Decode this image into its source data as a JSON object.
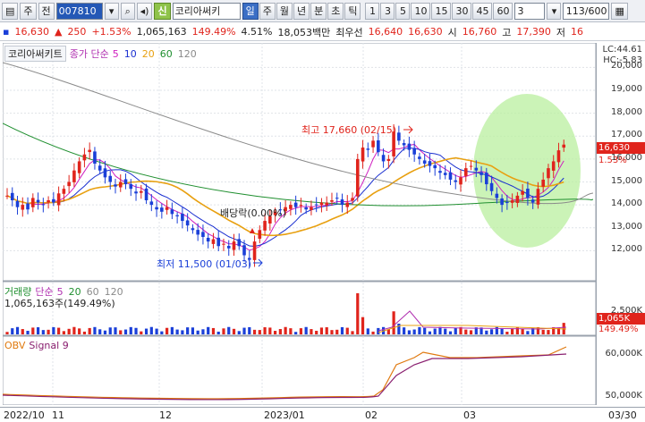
{
  "toolbar": {
    "market_label": "주",
    "prev_label": "전",
    "code_value": "007810",
    "type_badge": "신",
    "name_value": "코리아써키",
    "periods": [
      "일",
      "주",
      "월",
      "년",
      "분",
      "초",
      "틱"
    ],
    "selected_period": "일",
    "intervals": [
      "1",
      "3",
      "5",
      "10",
      "15",
      "30",
      "45",
      "60"
    ],
    "interval_value": "3",
    "count_value": "113/600"
  },
  "quote": {
    "price": "16,630",
    "arrow": "▲",
    "change": "250",
    "change_rate": "+1.53%",
    "volume": "1,065,163",
    "volume_ratio": "149.49%",
    "turnover": "4.51%",
    "amount": "18,053백만",
    "best_ask_label": "최우선",
    "best_ask": "16,640",
    "best_bid": "16,630",
    "open_label": "시",
    "open": "16,760",
    "high_label": "고",
    "high": "17,390",
    "low_label": "저",
    "low": "16"
  },
  "price_pane": {
    "stock_name": "코리아써키트",
    "ma_label": "종가 단순",
    "ma_periods": [
      "5",
      "10",
      "20",
      "60",
      "120"
    ],
    "ma_colors": [
      "#d020c0",
      "#1a2fd0",
      "#e8a010",
      "#1f8f2f",
      "#8a8a8a"
    ],
    "lc_label": "LC:44.61",
    "hc_label": "HC:-5.83",
    "y_ticks": [
      "20,000",
      "19,000",
      "18,000",
      "17,000",
      "16,000",
      "15,000",
      "14,000",
      "13,000",
      "12,000"
    ],
    "current_tag": "16,630",
    "current_rate": "1.53%",
    "high_annot": "최고 17,660 (02/15)",
    "low_annot": "최저 11,500 (01/03)",
    "dividend_annot": "배당락(0.00%)"
  },
  "volume_pane": {
    "label": "거래량",
    "ma_label": "단순",
    "ma_periods": [
      "5",
      "20",
      "60",
      "120"
    ],
    "value_text": "1,065,163주(149.49%)",
    "y_ticks": [
      "2,500K"
    ],
    "current_tag": "1,065K",
    "current_rate": "149.49%"
  },
  "obv_pane": {
    "label": "OBV",
    "signal_label": "Signal 9",
    "y_ticks": [
      "60,000K",
      "50,000K"
    ]
  },
  "date_axis": {
    "labels": [
      "2022/10",
      "11",
      "12",
      "2023/01",
      "02",
      "03"
    ],
    "end_label": "03/30"
  },
  "chart_data": {
    "type": "candlestick",
    "price_unit": "KRW",
    "highlight": "green ellipse over March 2023 rebound",
    "candles_close": [
      14400,
      14200,
      13900,
      14000,
      13800,
      14300,
      14100,
      14000,
      14200,
      14100,
      14500,
      14700,
      15000,
      15500,
      15900,
      16200,
      16400,
      15800,
      15500,
      15200,
      15000,
      14800,
      15000,
      14900,
      14700,
      14500,
      14600,
      14200,
      14000,
      13800,
      13700,
      13900,
      13600,
      13500,
      13300,
      13100,
      12900,
      12700,
      12600,
      12400,
      12500,
      12200,
      12300,
      12100,
      12400,
      12200,
      11800,
      11600,
      12400,
      12900,
      13300,
      13500,
      13700,
      13800,
      13900,
      14000,
      13900,
      14000,
      13800,
      13900,
      14000,
      14100,
      14100,
      14200,
      14300,
      14000,
      14100,
      14300,
      16000,
      16500,
      16400,
      16800,
      16300,
      15900,
      16000,
      17200,
      16800,
      16600,
      16400,
      16200,
      16000,
      15800,
      15700,
      15600,
      15400,
      15300,
      15100,
      15000,
      15200,
      15600,
      15700,
      15500,
      15300,
      14900,
      14600,
      14300,
      14000,
      14100,
      14200,
      14400,
      14600,
      14300,
      14100,
      14700,
      15100,
      15600,
      15900,
      16380,
      16630
    ],
    "ma5_last": 16000,
    "ma20_last": 15100,
    "volume_last_k": 1065,
    "obv_last_k": 63000
  }
}
